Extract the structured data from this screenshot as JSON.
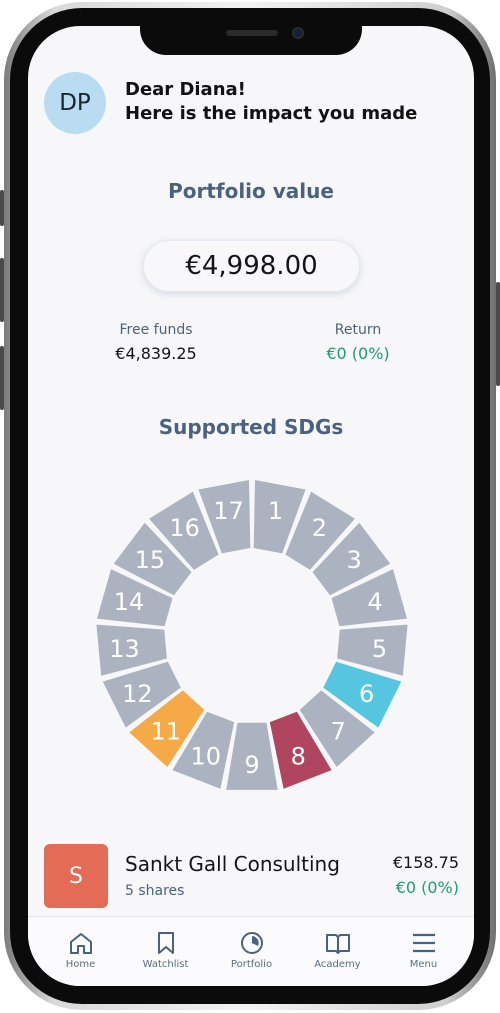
{
  "user": {
    "initials": "DP",
    "greeting_line1": "Dear Diana!",
    "greeting_line2": "Here is the impact you made"
  },
  "portfolio": {
    "title": "Portfolio value",
    "value": "€4,998.00",
    "free_funds_label": "Free funds",
    "free_funds_value": "€4,839.25",
    "return_label": "Return",
    "return_value": "€0 (0%)"
  },
  "sdgs": {
    "title": "Supported SDGs",
    "segments": [
      {
        "number": "1",
        "active": false
      },
      {
        "number": "2",
        "active": false
      },
      {
        "number": "3",
        "active": false
      },
      {
        "number": "4",
        "active": false
      },
      {
        "number": "5",
        "active": false
      },
      {
        "number": "6",
        "active": true,
        "color": "#56c6e0"
      },
      {
        "number": "7",
        "active": false
      },
      {
        "number": "8",
        "active": true,
        "color": "#b0455f"
      },
      {
        "number": "9",
        "active": false
      },
      {
        "number": "10",
        "active": false
      },
      {
        "number": "11",
        "active": true,
        "color": "#f5aa47"
      },
      {
        "number": "12",
        "active": false
      },
      {
        "number": "13",
        "active": false
      },
      {
        "number": "14",
        "active": false
      },
      {
        "number": "15",
        "active": false
      },
      {
        "number": "16",
        "active": false
      },
      {
        "number": "17",
        "active": false
      }
    ],
    "inactive_color": "#abb3c0"
  },
  "holding": {
    "logo_letter": "S",
    "name": "Sankt Gall Consulting",
    "shares": "5 shares",
    "price": "€158.75",
    "return": "€0 (0%)"
  },
  "tabs": [
    {
      "label": "Home",
      "icon": "home-icon"
    },
    {
      "label": "Watchlist",
      "icon": "bookmark-icon"
    },
    {
      "label": "Portfolio",
      "icon": "pie-chart-icon"
    },
    {
      "label": "Academy",
      "icon": "book-icon"
    },
    {
      "label": "Menu",
      "icon": "menu-icon"
    }
  ],
  "colors": {
    "accent_blue": "#4a6282",
    "positive_green": "#1f9e6a",
    "avatar_bg": "#b9dcf2",
    "logo_bg": "#e46b55"
  }
}
